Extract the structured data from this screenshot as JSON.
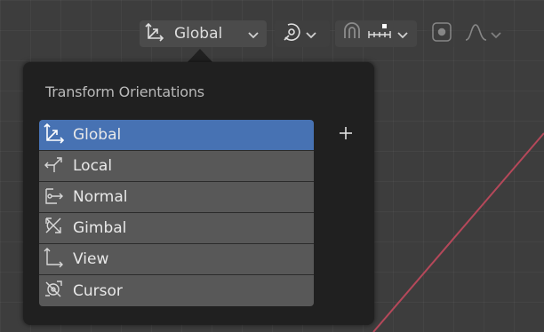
{
  "colors": {
    "viewport_bg": "#3d3d3d",
    "popup_bg": "#202020",
    "item_bg": "#585858",
    "selected_bg": "#4772b3",
    "axis_red": "#b5485a"
  },
  "header": {
    "orientation_label": "Global",
    "orientation_icon": "transform-orientation-icon",
    "pivot_icon": "pivot-point-icon",
    "snap_icon": "snap-magnet-icon",
    "snap_target_icon": "snap-increment-icon",
    "proportional_icon": "proportional-editing-icon",
    "falloff_icon": "falloff-curve-icon"
  },
  "popup": {
    "title": "Transform Orientations",
    "add_label": "+",
    "items": [
      {
        "label": "Global",
        "icon": "global-orientation-icon",
        "selected": true
      },
      {
        "label": "Local",
        "icon": "local-orientation-icon",
        "selected": false
      },
      {
        "label": "Normal",
        "icon": "normal-orientation-icon",
        "selected": false
      },
      {
        "label": "Gimbal",
        "icon": "gimbal-orientation-icon",
        "selected": false
      },
      {
        "label": "View",
        "icon": "view-orientation-icon",
        "selected": false
      },
      {
        "label": "Cursor",
        "icon": "cursor-orientation-icon",
        "selected": false
      }
    ]
  }
}
